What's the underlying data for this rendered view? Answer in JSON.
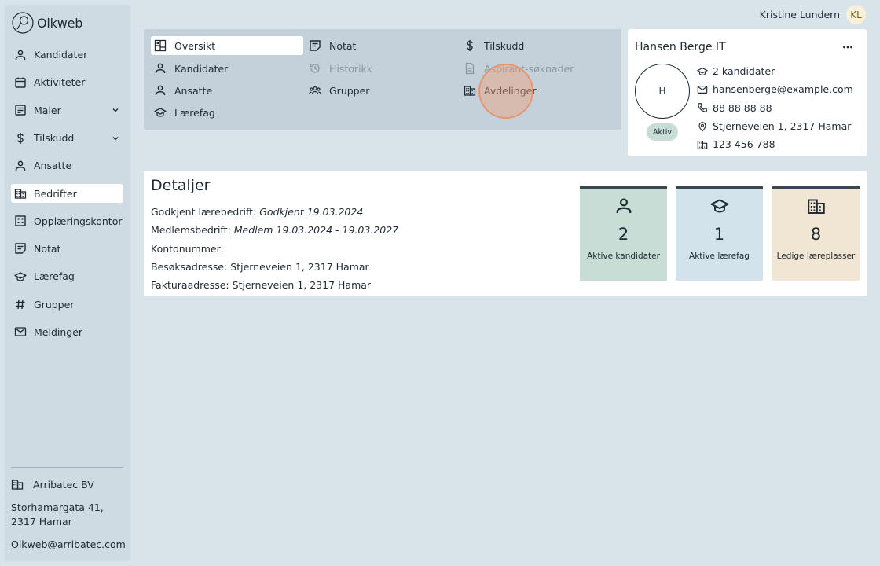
{
  "app": {
    "logo_text": "Olkweb"
  },
  "user": {
    "name": "Kristine Lundern",
    "initials": "KL"
  },
  "sidebar": {
    "items": [
      {
        "label": "Kandidater",
        "icon": "person-icon"
      },
      {
        "label": "Aktiviteter",
        "icon": "calendar-icon"
      },
      {
        "label": "Maler",
        "icon": "template-icon",
        "expandable": true
      },
      {
        "label": "Tilskudd",
        "icon": "dollar-icon",
        "expandable": true
      },
      {
        "label": "Ansatte",
        "icon": "person-icon"
      },
      {
        "label": "Bedrifter",
        "icon": "building-icon",
        "active": true
      },
      {
        "label": "Opplæringskontor",
        "icon": "office-icon"
      },
      {
        "label": "Notat",
        "icon": "note-icon"
      },
      {
        "label": "Lærefag",
        "icon": "graduation-cap-icon"
      },
      {
        "label": "Grupper",
        "icon": "hash-icon"
      },
      {
        "label": "Meldinger",
        "icon": "mail-icon"
      }
    ],
    "org": {
      "name": "Arribatec BV",
      "address": "Storhamargata 41, 2317 Hamar",
      "email": "Olkweb@arribatec.com"
    }
  },
  "tabs": [
    {
      "label": "Oversikt",
      "icon": "dashboard-icon",
      "active": true
    },
    {
      "label": "Kandidater",
      "icon": "person-icon"
    },
    {
      "label": "Ansatte",
      "icon": "person-icon"
    },
    {
      "label": "Lærefag",
      "icon": "graduation-cap-icon"
    },
    {
      "label": "Notat",
      "icon": "note-icon"
    },
    {
      "label": "Historikk",
      "icon": "history-icon",
      "disabled": true
    },
    {
      "label": "Grupper",
      "icon": "group-icon"
    },
    {
      "label": "Tilskudd",
      "icon": "dollar-icon"
    },
    {
      "label": "Aspirant-søknader",
      "icon": "document-icon",
      "disabled": true
    },
    {
      "label": "Avdelinger",
      "icon": "building-icon"
    }
  ],
  "company": {
    "name": "Hansen Berge IT",
    "avatar_letter": "H",
    "status": "Aktiv",
    "candidates": "2 kandidater",
    "email": "hansenberge@example.com",
    "phone": "88 88 88 88",
    "address": "Stjerneveien 1, 2317 Hamar",
    "org_number": "123 456 788"
  },
  "details": {
    "title": "Detaljer",
    "rows": [
      {
        "key": "Godkjent lærebedrift:",
        "value": "Godkjent 19.03.2024",
        "italic": true
      },
      {
        "key": "Medlemsbedrift:",
        "value": "Medlem 19.03.2024 - 19.03.2027",
        "italic": true
      },
      {
        "key": "Kontonummer:",
        "value": ""
      },
      {
        "key": "Besøksadresse:",
        "value": "Stjerneveien 1, 2317 Hamar"
      },
      {
        "key": "Fakturaadresse:",
        "value": "Stjerneveien 1, 2317 Hamar"
      }
    ],
    "stats": [
      {
        "value": "2",
        "label": "Aktive kandidater",
        "icon": "person-icon",
        "color": "#c7ddd5"
      },
      {
        "value": "1",
        "label": "Aktive lærefag",
        "icon": "graduation-cap-icon",
        "color": "#d3e3ec"
      },
      {
        "value": "8",
        "label": "Ledige læreplasser",
        "icon": "building-icon",
        "color": "#f1e6d3"
      }
    ]
  }
}
